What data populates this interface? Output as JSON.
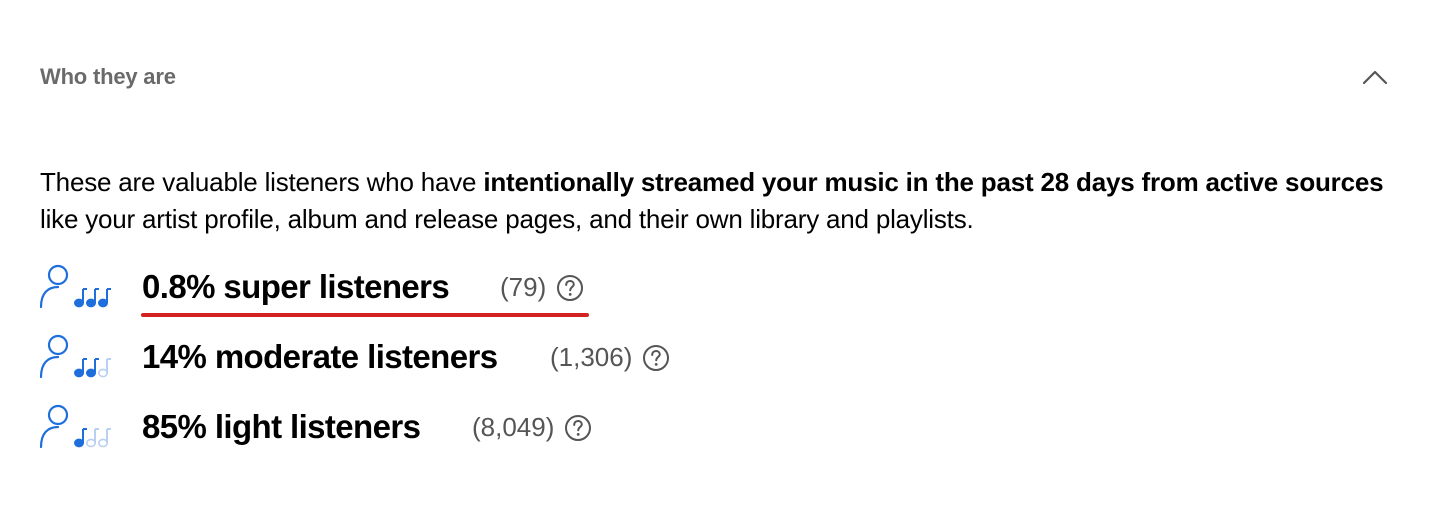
{
  "section": {
    "title": "Who they are",
    "expanded": true,
    "toggle_icon": "chevron-up-icon"
  },
  "description": {
    "lead": "These are valuable listeners who have ",
    "emphasis": "intentionally streamed your music in the past 28 days from active sources",
    "tail": " like your artist profile, album and release pages, and their own library and playlists."
  },
  "listener_tiers": [
    {
      "label": "0.8% super listeners",
      "count": "(79)",
      "icon": "super-listener-icon",
      "filled_notes": 3,
      "highlighted": true
    },
    {
      "label": "14% moderate listeners",
      "count": "(1,306)",
      "icon": "moderate-listener-icon",
      "filled_notes": 2,
      "highlighted": false
    },
    {
      "label": "85% light listeners",
      "count": "(8,049)",
      "icon": "light-listener-icon",
      "filled_notes": 1,
      "highlighted": false
    }
  ],
  "colors": {
    "accent_blue": "#1e6fdb",
    "faded_blue": "#b9d0f3",
    "highlight_underline": "#d32222",
    "muted_text": "#6a6a6a"
  }
}
